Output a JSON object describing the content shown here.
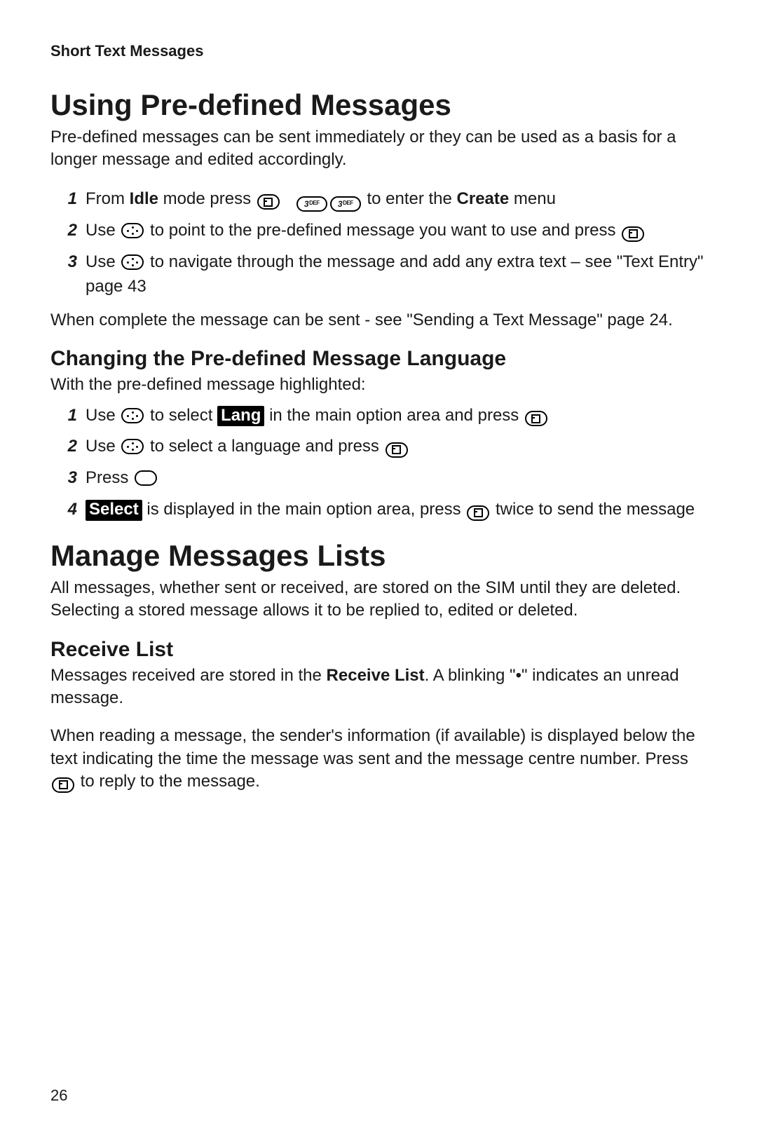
{
  "runningHead": "Short Text Messages",
  "pageNumber": "26",
  "h1a": "Using Pre-defined Messages",
  "intro1": "Pre-defined messages can be sent immediately or they can be used as a basis for a longer message and edited accordingly.",
  "stepsA": {
    "s1_pre": "From ",
    "s1_bold1": "Idle",
    "s1_mid": " mode press ",
    "s1_post": " to enter the ",
    "s1_bold2": "Create",
    "s1_end": " menu",
    "s2_pre": "Use ",
    "s2_mid": " to point to the pre-defined message you want to use and press ",
    "s3_pre": "Use ",
    "s3_post": " to navigate through the message and add any extra text – see \"Text Entry\" page 43"
  },
  "after1": "When complete the message can be sent - see \"Sending a Text Message\" page 24.",
  "h2a": "Changing the Pre-defined Message Language",
  "intro2": "With the pre-defined message highlighted:",
  "stepsB": {
    "s1_pre": "Use ",
    "s1_mid": " to select ",
    "s1_lang": "Lang",
    "s1_post": " in the main option area and press ",
    "s2_pre": "Use ",
    "s2_post": " to select a language and press ",
    "s3_pre": "Press ",
    "s4_sel": "Select",
    "s4_post": " is displayed in the main option area,  press ",
    "s4_end": " twice to send the message"
  },
  "h1b": "Manage Messages Lists",
  "intro3": "All messages, whether sent or received, are stored on the SIM until they are deleted. Selecting a stored message allows it to be replied to, edited or deleted.",
  "h2b": "Receive List",
  "rl1_pre": "Messages received are stored in the ",
  "rl1_bold": "Receive List",
  "rl1_post": ". A blinking \"•\" indicates an unread message.",
  "rl2_pre": "When reading a message, the sender's information (if available) is displayed below the text indicating the time the message was sent and the message centre number. Press ",
  "rl2_post": " to reply to the message.",
  "keyNum": {
    "digit": "3",
    "letters": "DEF"
  }
}
